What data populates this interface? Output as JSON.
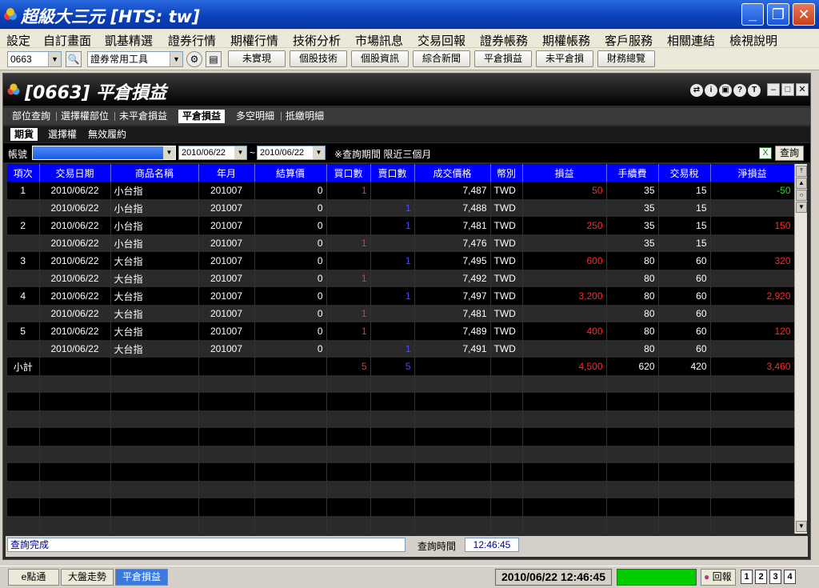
{
  "window": {
    "title": "超級大三元  [HTS: tw]"
  },
  "menu": [
    "設定",
    "自訂畫面",
    "凱基精選",
    "證券行情",
    "期權行情",
    "技術分析",
    "市場訊息",
    "交易回報",
    "證券帳務",
    "期權帳務",
    "客戶服務",
    "相關連結",
    "檢視說明"
  ],
  "toolbar": {
    "code_value": "0663",
    "tool_combo": "證券常用工具",
    "buttons": [
      "未實現",
      "個股技術",
      "個股資訊",
      "綜合新聞",
      "平倉損益",
      "未平倉損",
      "財務總覽"
    ]
  },
  "panel": {
    "title": "[0663] 平倉損益",
    "tabs": [
      "部位查詢",
      "選擇權部位",
      "未平倉損益",
      "平倉損益",
      "多空明細",
      "抵繳明細"
    ],
    "subtabs": [
      "期貨",
      "選擇權",
      "無效履約"
    ],
    "filter": {
      "account_label": "帳號",
      "date_from": "2010/06/22",
      "tilde": "~",
      "date_to": "2010/06/22",
      "note": "※查詢期間 限近三個月",
      "query_button": "查詢"
    },
    "columns": [
      "項次",
      "交易日期",
      "商品名稱",
      "年月",
      "結算價",
      "買口數",
      "賣口數",
      "成交價格",
      "幣別",
      "損益",
      "手續費",
      "交易稅",
      "淨損益"
    ],
    "rows": [
      {
        "idx": "1",
        "date": "2010/06/22",
        "product": "小台指",
        "ym": "201007",
        "settle": "0",
        "buy": "1",
        "sell": "",
        "price": "7,487",
        "cur": "TWD",
        "pl": "50",
        "fee": "35",
        "tax": "15",
        "net": "-50"
      },
      {
        "idx": "",
        "date": "2010/06/22",
        "product": "小台指",
        "ym": "201007",
        "settle": "0",
        "buy": "",
        "sell": "1",
        "price": "7,488",
        "cur": "TWD",
        "pl": "",
        "fee": "35",
        "tax": "15",
        "net": ""
      },
      {
        "idx": "2",
        "date": "2010/06/22",
        "product": "小台指",
        "ym": "201007",
        "settle": "0",
        "buy": "",
        "sell": "1",
        "price": "7,481",
        "cur": "TWD",
        "pl": "250",
        "fee": "35",
        "tax": "15",
        "net": "150"
      },
      {
        "idx": "",
        "date": "2010/06/22",
        "product": "小台指",
        "ym": "201007",
        "settle": "0",
        "buy": "1",
        "sell": "",
        "price": "7,476",
        "cur": "TWD",
        "pl": "",
        "fee": "35",
        "tax": "15",
        "net": ""
      },
      {
        "idx": "3",
        "date": "2010/06/22",
        "product": "大台指",
        "ym": "201007",
        "settle": "0",
        "buy": "",
        "sell": "1",
        "price": "7,495",
        "cur": "TWD",
        "pl": "600",
        "fee": "80",
        "tax": "60",
        "net": "320"
      },
      {
        "idx": "",
        "date": "2010/06/22",
        "product": "大台指",
        "ym": "201007",
        "settle": "0",
        "buy": "1",
        "sell": "",
        "price": "7,492",
        "cur": "TWD",
        "pl": "",
        "fee": "80",
        "tax": "60",
        "net": ""
      },
      {
        "idx": "4",
        "date": "2010/06/22",
        "product": "大台指",
        "ym": "201007",
        "settle": "0",
        "buy": "",
        "sell": "1",
        "price": "7,497",
        "cur": "TWD",
        "pl": "3,200",
        "fee": "80",
        "tax": "60",
        "net": "2,920"
      },
      {
        "idx": "",
        "date": "2010/06/22",
        "product": "大台指",
        "ym": "201007",
        "settle": "0",
        "buy": "1",
        "sell": "",
        "price": "7,481",
        "cur": "TWD",
        "pl": "",
        "fee": "80",
        "tax": "60",
        "net": ""
      },
      {
        "idx": "5",
        "date": "2010/06/22",
        "product": "大台指",
        "ym": "201007",
        "settle": "0",
        "buy": "1",
        "sell": "",
        "price": "7,489",
        "cur": "TWD",
        "pl": "400",
        "fee": "80",
        "tax": "60",
        "net": "120"
      },
      {
        "idx": "",
        "date": "2010/06/22",
        "product": "大台指",
        "ym": "201007",
        "settle": "0",
        "buy": "",
        "sell": "1",
        "price": "7,491",
        "cur": "TWD",
        "pl": "",
        "fee": "80",
        "tax": "60",
        "net": ""
      }
    ],
    "subtotal": {
      "idx": "小計",
      "date": "",
      "product": "",
      "ym": "",
      "settle": "",
      "buy": "5",
      "sell": "5",
      "price": "",
      "cur": "",
      "pl": "4,500",
      "fee": "620",
      "tax": "420",
      "net": "3,460"
    },
    "status": {
      "message": "查詢完成",
      "time_label": "查詢時間",
      "time_value": "12:46:45"
    }
  },
  "bottom": {
    "tabs": [
      "e點通",
      "大盤走勢",
      "平倉損益"
    ],
    "clock": "2010/06/22 12:46:45",
    "report": "回報",
    "nums": [
      "1",
      "2",
      "3",
      "4"
    ]
  },
  "colors": {
    "header_blue": "#0000ff",
    "loss_green": "#2ad42a",
    "profit_red": "#ff2a2a",
    "sell_blue": "#4a4aff"
  }
}
